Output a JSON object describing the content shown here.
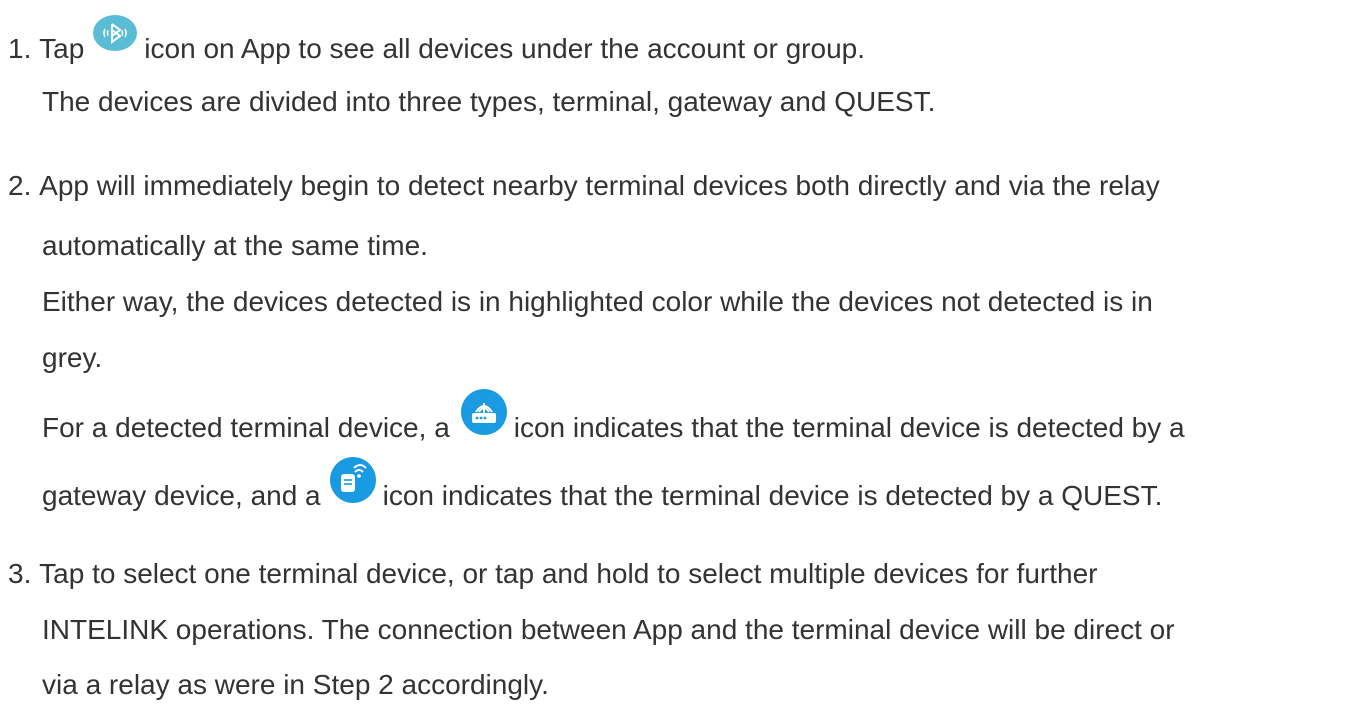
{
  "instructions": {
    "step1": {
      "number": "1.",
      "line1_before_icon": "Tap",
      "line1_after_icon": "icon on App to see all devices under the account or group.",
      "line2": "The devices are divided into three types, terminal, gateway and QUEST."
    },
    "step2": {
      "number": "2.",
      "line1": "App will immediately begin to detect nearby terminal devices both directly and via the relay",
      "line2": "automatically at the same time.",
      "line3": "Either way, the devices detected is in highlighted color while the devices not detected is in",
      "line4": "grey.",
      "line5_before_icon": "For a detected terminal device, a",
      "line5_after_icon": "icon indicates that the terminal device is detected by a",
      "line6_before_icon": "gateway device, and a",
      "line6_after_icon": "icon indicates that the terminal device is detected by a QUEST."
    },
    "step3": {
      "number": "3.",
      "line1": "Tap to select one terminal device, or tap and hold to select multiple devices for further",
      "line2": "INTELINK operations. The connection between App and the terminal device will be direct or",
      "line3": "via a relay as were in Step 2 accordingly."
    }
  },
  "icons": {
    "bluetooth": "bluetooth-scan-icon",
    "gateway": "gateway-router-icon",
    "quest": "quest-radio-icon"
  },
  "colors": {
    "text": "#333333",
    "bluetooth_icon": "#5bbcd6",
    "badge_icon": "#1a9ae0"
  }
}
